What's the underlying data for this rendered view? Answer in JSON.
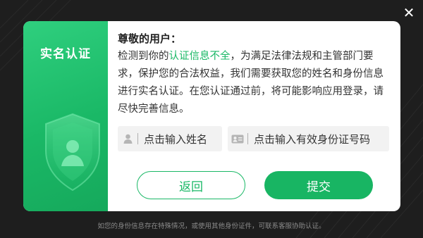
{
  "dialog": {
    "side_title": "实名认证",
    "greeting": "尊敬的用户：",
    "message_before": "检测到你的",
    "message_highlight": "认证信息不全",
    "message_after": "，为满足法律法规和主管部门要求，保护您的合法权益，我们需要获取您的姓名和身份信息进行实名认证。在您认证通过前，将可能影响应用登录，请尽快完善信息。",
    "name_placeholder": "点击输入姓名",
    "id_placeholder": "点击输入有效身份证号码",
    "back_label": "返回",
    "submit_label": "提交"
  },
  "footer": {
    "note": "如您的身份信息存在特殊情况，或使用其他身份证件，可联系客服协助认证。"
  },
  "close_symbol": "✕",
  "colors": {
    "accent": "#1ab866",
    "background": "#1e1e1e"
  },
  "icons": {
    "close": "close-icon",
    "user": "user-icon",
    "id_card": "id-card-icon",
    "shield": "shield-user-icon"
  }
}
